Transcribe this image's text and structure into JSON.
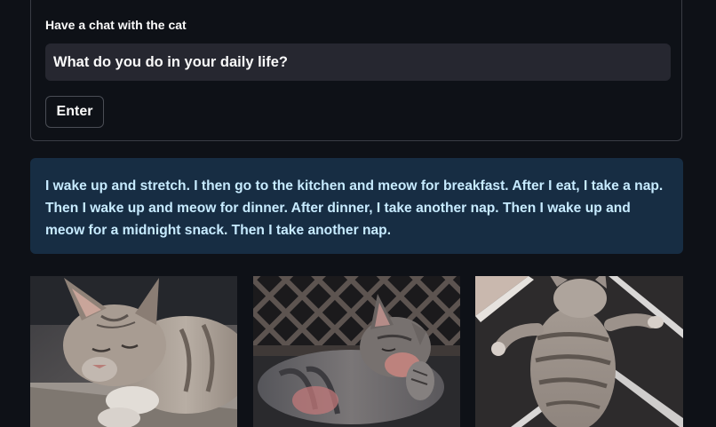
{
  "form": {
    "label": "Have a chat with the cat",
    "input_value": "What do you do in your daily life?",
    "button_label": "Enter"
  },
  "answer": {
    "text": "I wake up and stretch. I then go to the kitchen and meow for breakfast. After I eat, I take a nap. Then I wake up and meow for dinner. After dinner, I take another nap. Then I wake up and meow for a midnight snack. Then I take another nap."
  },
  "images": [
    {
      "subject": "sleeping-tabby-cat"
    },
    {
      "subject": "tabby-cat-grooming-by-lattice"
    },
    {
      "subject": "tabby-cat-lying-on-tiles"
    }
  ]
}
